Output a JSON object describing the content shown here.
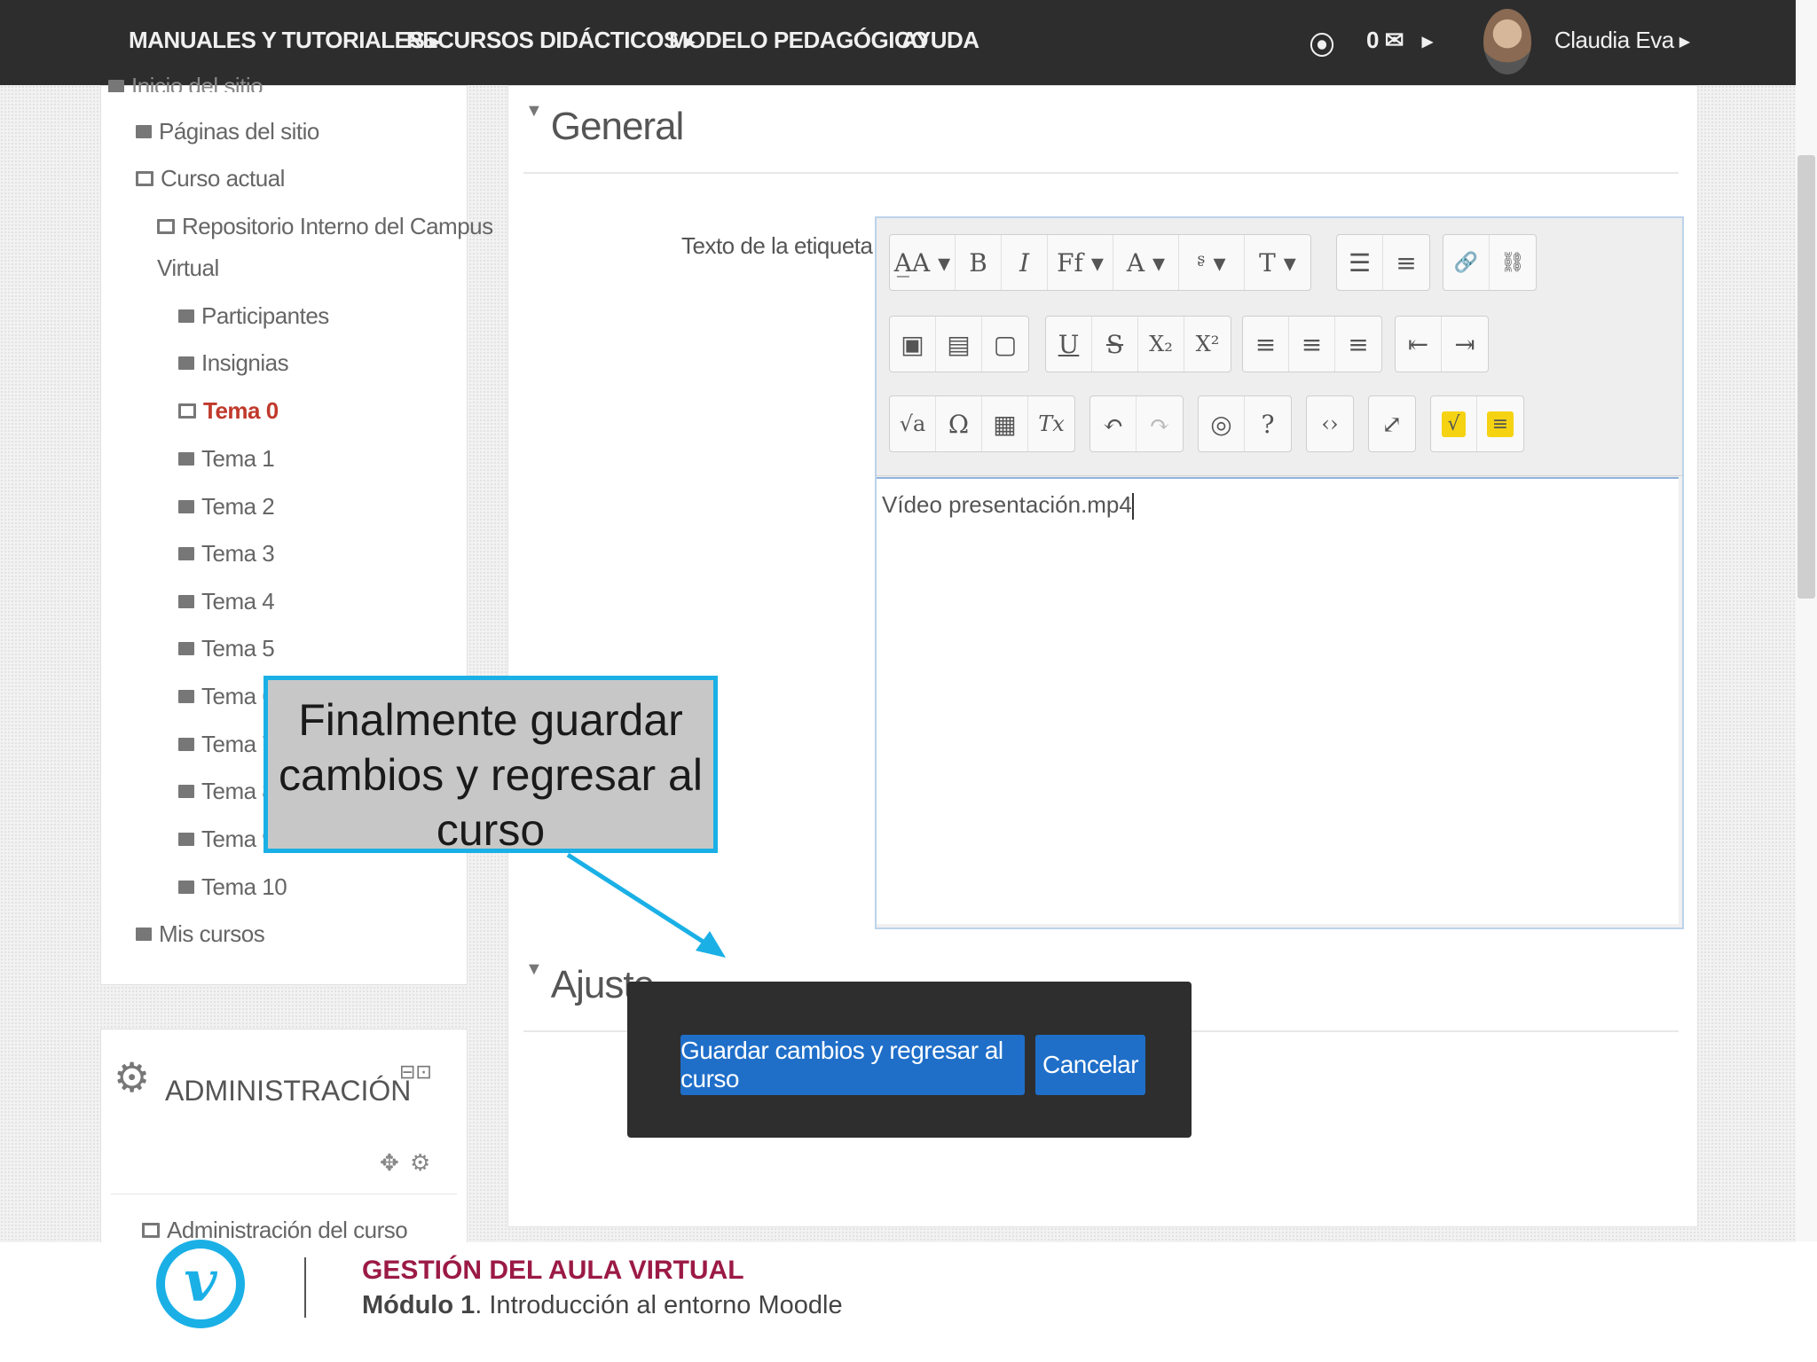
{
  "navbar": {
    "items": [
      {
        "label": "MANUALES Y TUTORIALES",
        "has_caret": true
      },
      {
        "label": "RECURSOS DIDÁCTICOS",
        "has_caret": true
      },
      {
        "label": "MODELO PEDAGÓGICO",
        "has_caret": false
      },
      {
        "label": "AYUDA",
        "has_caret": false
      }
    ],
    "message_count": "0",
    "user_name": "Claudia Eva"
  },
  "nav_block": {
    "items": [
      {
        "label": "Inicio del sitio"
      },
      {
        "label": "Páginas del sitio"
      },
      {
        "label": "Curso actual"
      },
      {
        "label": "Repositorio Interno del Campus",
        "label2": "Virtual"
      },
      {
        "label": "Participantes"
      },
      {
        "label": "Insignias"
      },
      {
        "label": "Tema 0"
      },
      {
        "label": "Tema 1"
      },
      {
        "label": "Tema 2"
      },
      {
        "label": "Tema 3"
      },
      {
        "label": "Tema 4"
      },
      {
        "label": "Tema 5"
      },
      {
        "label": "Tema 6"
      },
      {
        "label": "Tema 7"
      },
      {
        "label": "Tema 8"
      },
      {
        "label": "Tema 9"
      },
      {
        "label": "Tema 10"
      },
      {
        "label": "Mis cursos"
      }
    ]
  },
  "admin_block": {
    "title": "ADMINISTRACIÓN",
    "item": "Administración del curso"
  },
  "form": {
    "general_title": "General",
    "field_label": "Texto de la etiqueta",
    "editor_content": "Vídeo presentación.mp4",
    "ajustes_title": "Ajuste"
  },
  "toolbar": {
    "row1": [
      [
        "A̲A ▾",
        "B",
        "I",
        "Ff ▾",
        "A ▾",
        "ᶳ ▾",
        "T ▾"
      ],
      [
        "☰",
        "≡"
      ],
      [
        "🔗",
        "⛓"
      ]
    ],
    "row2": [
      [
        "▣",
        "▤",
        "▢"
      ],
      [
        "U",
        "S",
        "X₂",
        "X²"
      ],
      [
        "≡",
        "≡",
        "≡"
      ],
      [
        "⇤",
        "⇥"
      ]
    ],
    "row3": [
      [
        "√a",
        "Ω",
        "▦",
        "Tx"
      ],
      [
        "↶",
        "↷"
      ],
      [
        "◎",
        "?"
      ],
      [
        "‹›"
      ],
      [
        "⤢"
      ],
      [
        "√",
        "≡"
      ]
    ]
  },
  "callout": {
    "text": "Finalmente guardar cambios y regresar al curso"
  },
  "dialog": {
    "save_label": "Guardar cambios y regresar al curso",
    "cancel_label": "Cancelar"
  },
  "footer": {
    "logo_letter": "v",
    "title": "GESTIÓN DEL AULA VIRTUAL",
    "subtitle_bold": "Módulo 1",
    "subtitle_rest": ". Introducción al entorno Moodle"
  },
  "colors": {
    "navbar": "#2d2d2d",
    "accent_blue": "#1ab0e6",
    "button_blue": "#1f6fc9",
    "footer_title": "#9b1a45",
    "current_node": "#c0392b"
  }
}
